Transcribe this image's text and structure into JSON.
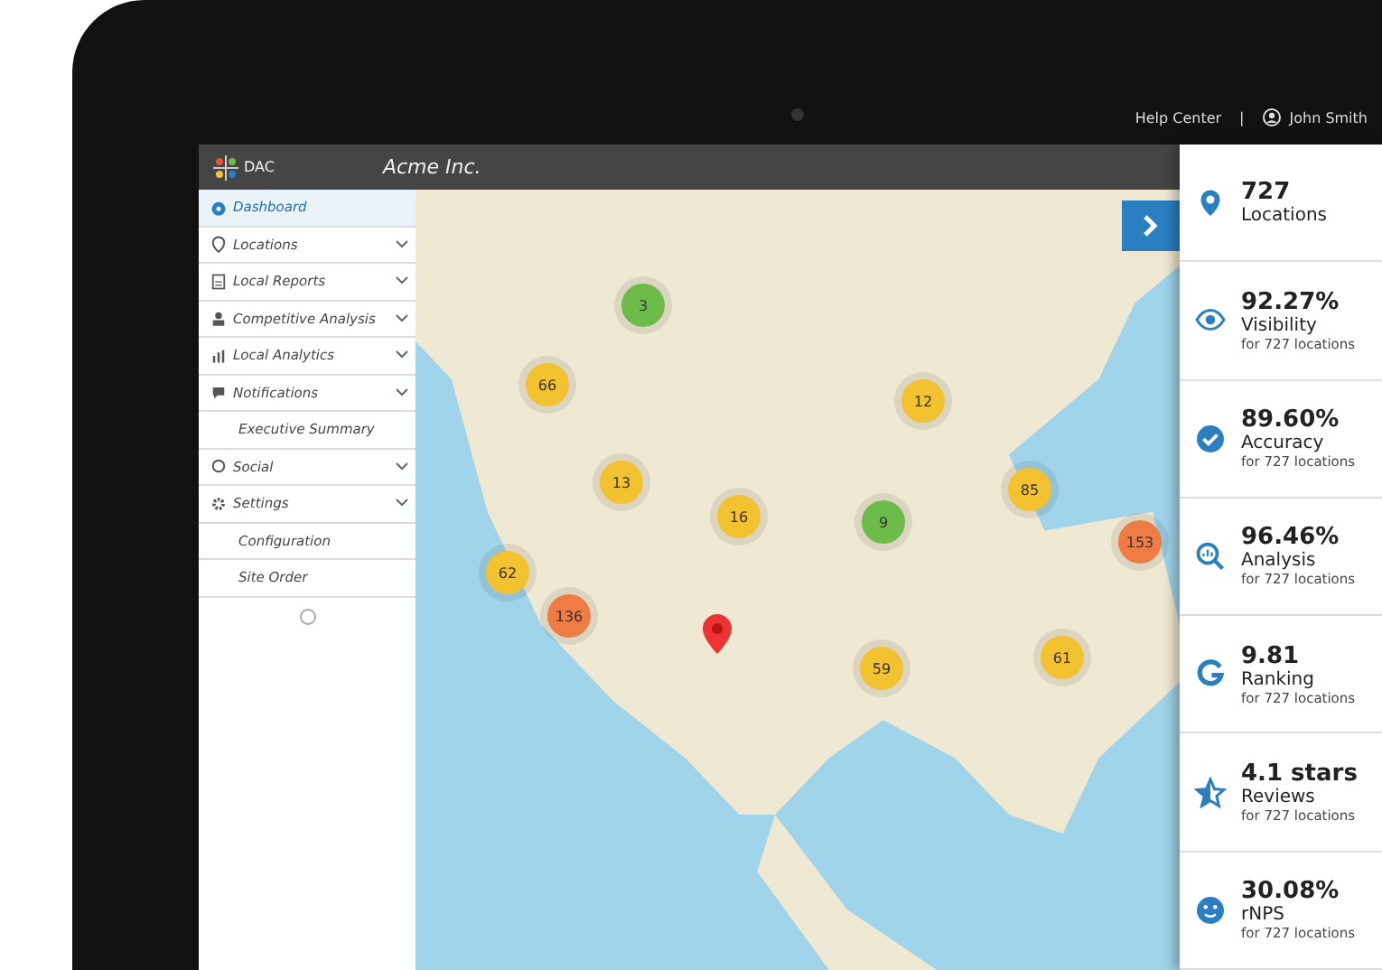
{
  "top_bar": {
    "help_link": "Help Center",
    "separator": "|",
    "user_name": "John Smith"
  },
  "app_header": {
    "logo_text": "DAC",
    "account_name": "Acme Inc."
  },
  "sidebar": {
    "items": [
      {
        "label": "Dashboard",
        "kind": "link",
        "selected": true
      },
      {
        "label": "Locations",
        "kind": "group",
        "selected": false
      },
      {
        "label": "Local Reports",
        "kind": "group",
        "selected": false
      },
      {
        "label": "Competitive Analysis",
        "kind": "group",
        "selected": false
      },
      {
        "label": "Local Analytics",
        "kind": "group",
        "selected": false
      },
      {
        "label": "Notifications",
        "kind": "group",
        "selected": false
      },
      {
        "label": "Executive Summary",
        "kind": "subitem",
        "selected": false
      },
      {
        "label": "Social",
        "kind": "group",
        "selected": false
      },
      {
        "label": "Settings",
        "kind": "group",
        "selected": false
      },
      {
        "label": "Configuration",
        "kind": "subitem",
        "selected": false
      },
      {
        "label": "Site Order",
        "kind": "subitem",
        "selected": false
      }
    ]
  },
  "map": {
    "clusters": [
      {
        "count": "3",
        "color": "#6dbb4a"
      },
      {
        "count": "66",
        "color": "#f2c230"
      },
      {
        "count": "12",
        "color": "#f2c230"
      },
      {
        "count": "13",
        "color": "#f2c230"
      },
      {
        "count": "16",
        "color": "#f2c230"
      },
      {
        "count": "9",
        "color": "#6dbb4a"
      },
      {
        "count": "85",
        "color": "#f2c230"
      },
      {
        "count": "153",
        "color": "#ee7d45"
      },
      {
        "count": "62",
        "color": "#f2c230"
      },
      {
        "count": "136",
        "color": "#ee7d45"
      },
      {
        "count": "59",
        "color": "#f2c230"
      },
      {
        "count": "61",
        "color": "#f2c230"
      }
    ]
  },
  "stats": [
    {
      "value": "727",
      "label": "Locations"
    },
    {
      "value": "92.27%",
      "label": "Visibility",
      "note": "for 727 locations"
    },
    {
      "value": "89.60%",
      "label": "Accuracy",
      "note": "for 727 locations"
    },
    {
      "value": "96.46%",
      "label": "Analysis",
      "note": "for 727 locations"
    },
    {
      "value": "9.81",
      "label": "Ranking",
      "note": "for 727 locations"
    },
    {
      "value": "4.1 stars",
      "label": "Reviews",
      "note": "for 727 locations"
    },
    {
      "value": "30.08%",
      "label": "rNPS",
      "note": "for 727 locations"
    }
  ]
}
